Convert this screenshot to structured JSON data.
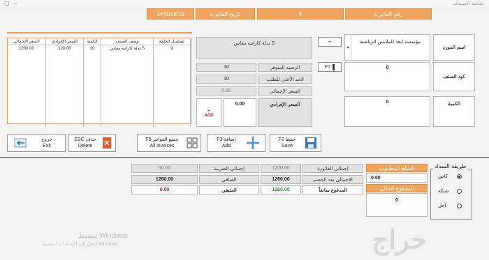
{
  "window": {
    "title": "شاشة المبيعات",
    "icon": "app-icon"
  },
  "header": {
    "invoice_type_label": "رقم الفاتورة",
    "invoice_number": "6",
    "invoice_date_label": "تاريخ الفاتورة",
    "invoice_date": "1441/08/19"
  },
  "form": {
    "supplier_label": "اسم المورد",
    "supplier_value": "مؤسسة ابعد للملابس الرياضية",
    "item_code_label": "كود الصنف",
    "item_code_value": "0",
    "quantity_label": "الكمية",
    "quantity_value": "0",
    "add_supplier_button": "+",
    "item_search_button": "F1",
    "item_name_value": "بدلة كاراتيه مقاس S",
    "balance_label": "الرصيد المتوفر",
    "balance_value": "10",
    "max_limit_label": "الحد الأعلى للطلب",
    "max_limit_value": "10",
    "total_price_label": "السعر الإجمالي",
    "total_price_value": "0.00",
    "unit_price_label": "السعر الإفرادي",
    "unit_price_value": "0.00",
    "add_button_label": "ADD"
  },
  "grid": {
    "columns": [
      "تسلسل الحلقة",
      "وصف الصنف",
      "الكمية",
      "السعر الإفرادي",
      "السعر الإجمالي"
    ],
    "rows": [
      {
        "seq": "9",
        "desc": "بدلة كاراتيه مقاس S",
        "qty": "10",
        "unit": "120.00",
        "total": "1200.00"
      }
    ]
  },
  "buttons": {
    "save": {
      "key": "F2",
      "arabic": "حفظ",
      "label": "Save"
    },
    "add": {
      "key": "F3",
      "arabic": "إضافة",
      "label": "Add"
    },
    "all_invoices": {
      "key": "F5",
      "arabic": "جميع الفواتير",
      "label": "All invoices"
    },
    "delete": {
      "key": "ESC",
      "arabic": "حذف",
      "label": "Delete"
    },
    "exit": {
      "key": "",
      "arabic": "خروج",
      "label": "Exit"
    }
  },
  "payment": {
    "method_label": "طريقة السداد",
    "options": [
      "كاش",
      "شبكة",
      "آجل"
    ],
    "selected": 0,
    "amount_due_label": "المبلغ المطلوب",
    "amount_due_value": "0.00",
    "paid_now_label": "المدفوع الحالي",
    "paid_now_value": "0",
    "invoice_total_label": "إجمالي الفاتورة",
    "invoice_total_value": "1200.00",
    "tax_total_label": "إجمالي الضريبة",
    "tax_total_value": "60.00",
    "after_discount_label": "الإجمالي بعد الخصم",
    "after_discount_value": "1260.00",
    "net_label": "الصافي",
    "net_value": "1260.00",
    "prepaid_label": "المدفوع سابقاً",
    "prepaid_value": "1260.00",
    "remaining_label": "المتبقي",
    "remaining_value": "0.00"
  },
  "watermark": {
    "line1": "تنشيط Windows",
    "line2": "انتقل إلى الإعدادات لتنشيط Windows.",
    "brand": "حراج"
  },
  "colors": {
    "accent": "#f0a55e",
    "green": "#2e9a2e",
    "red": "#d32020"
  }
}
